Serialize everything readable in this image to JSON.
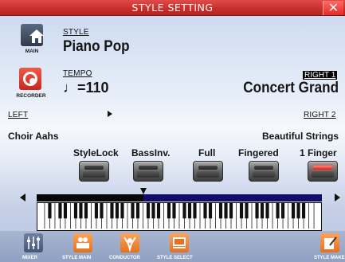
{
  "title": "STYLE SETTING",
  "close_icon": "close-x",
  "side_buttons": {
    "main_label": "MAIN",
    "recorder_label": "RECORDER"
  },
  "style": {
    "label": "STYLE",
    "value": "Piano Pop"
  },
  "tempo": {
    "label": "TEMPO",
    "value": "♩=110"
  },
  "right1": {
    "label": "RIGHT 1",
    "value": "Concert Grand"
  },
  "left": {
    "label": "LEFT",
    "value": "Choir Aahs"
  },
  "right2": {
    "label": "RIGHT 2",
    "value": "Beautiful Strings"
  },
  "toggles": [
    {
      "label": "StyleLock",
      "on": false
    },
    {
      "label": "BassInv.",
      "on": false
    },
    {
      "label": "Full",
      "on": false
    },
    {
      "label": "Fingered",
      "on": false
    },
    {
      "label": "1 Finger",
      "on": true
    }
  ],
  "bottom_nav": [
    {
      "label": "MIXER",
      "icon": "mixer-icon"
    },
    {
      "label": "STYLE MAIN",
      "icon": "style-main-icon"
    },
    {
      "label": "CONDUCTOR",
      "icon": "conductor-icon"
    },
    {
      "label": "STYLE SELECT",
      "icon": "style-select-icon"
    },
    {
      "label": "STYLE MAKE",
      "icon": "style-make-icon"
    }
  ],
  "colors": {
    "titlebar": "#c9302d",
    "split_left": "#080808",
    "split_right": "#120c6b",
    "led_on": "#e01b10"
  }
}
